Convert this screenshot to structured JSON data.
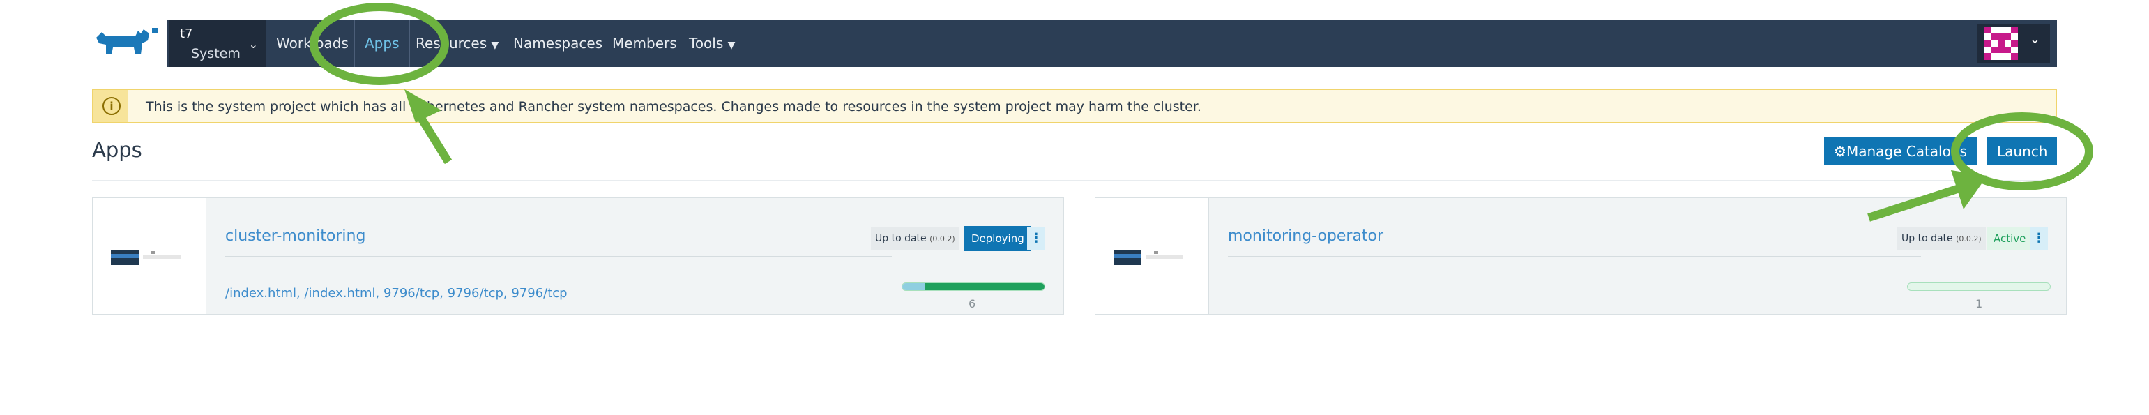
{
  "header": {
    "project_top": "t7",
    "project_bottom": "System",
    "nav": [
      {
        "label": "Workloads"
      },
      {
        "label": "Apps"
      },
      {
        "label": "Resources"
      },
      {
        "label": "Namespaces"
      },
      {
        "label": "Members"
      },
      {
        "label": "Tools"
      }
    ]
  },
  "banner": {
    "text": "This is the system project which has all Kubernetes and Rancher system namespaces. Changes made to resources in the system project may harm the cluster."
  },
  "page": {
    "title": "Apps",
    "manage_catalogs_label": "Manage Catalogs",
    "launch_label": "Launch"
  },
  "apps": [
    {
      "name": "cluster-monitoring",
      "status_label": "Up to date",
      "version": "(0.0.2)",
      "state": "Deploying",
      "endpoints": "/index.html, /index.html, 9796/tcp, 9796/tcp, 9796/tcp",
      "pods_count": "6"
    },
    {
      "name": "monitoring-operator",
      "status_label": "Up to date",
      "version": "(0.0.2)",
      "state": "Active",
      "endpoints": "",
      "pods_count": "1"
    }
  ],
  "colors": {
    "accent": "#0f75b3",
    "navbar": "#2c3e55",
    "annotation": "#6db33f"
  }
}
